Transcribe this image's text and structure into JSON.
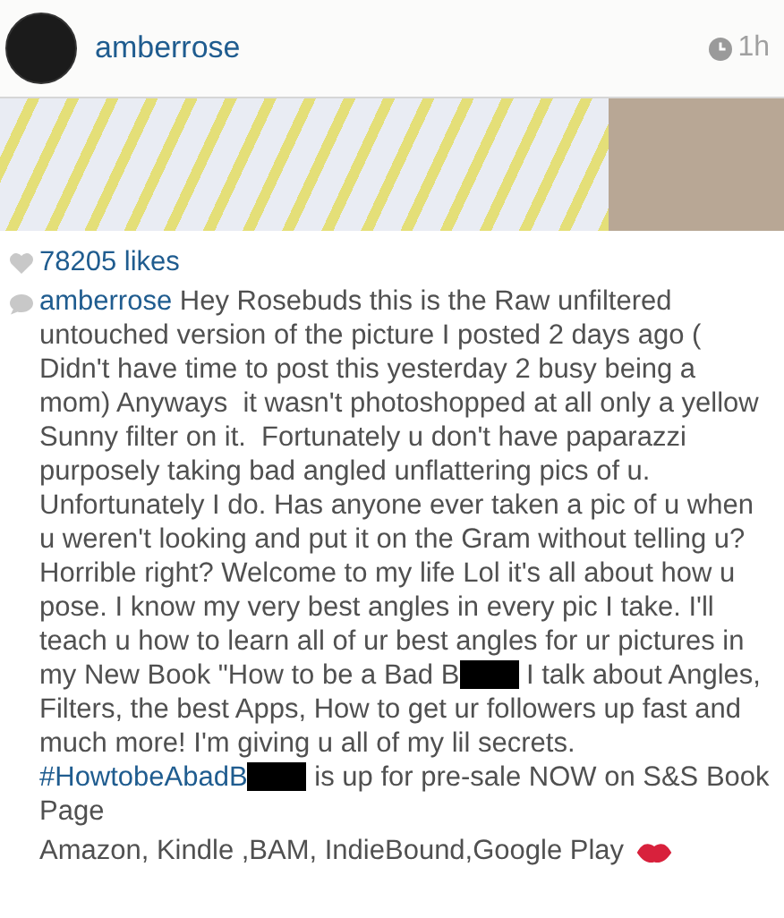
{
  "post": {
    "username": "amberrose",
    "time": "1h"
  },
  "likes": "78205 likes",
  "caption": {
    "username": "amberrose",
    "segments": [
      {
        "kind": "text",
        "text": "Hey Rosebuds this is the Raw unfiltered untouched version of the picture I posted 2 days ago ( Didn't have time to post this yesterday 2 busy being a mom) Anyways  it wasn't photoshopped at all only a yellow Sunny filter on it.  Fortunately u don't have paparazzi purposely taking bad angled unflattering pics of u. Unfortunately I do. Has anyone ever taken a pic of u when u weren't looking and put it on the Gram without telling u? Horrible right? Welcome to my life Lol it's all about how u pose. I know my very best angles in every pic I take. I'll teach u how to learn all of ur best angles for ur pictures in my New Book \"How to be a Bad B"
      },
      {
        "kind": "redaction"
      },
      {
        "kind": "text",
        "text": " I talk about Angles, Filters, the best Apps, How to get ur followers up fast and much more! I'm giving u all of my lil secrets. "
      },
      {
        "kind": "hashtag",
        "text": "#HowtobeAbadB"
      },
      {
        "kind": "redaction"
      },
      {
        "kind": "text",
        "text": " is up for pre-sale NOW on S&S Book Page"
      }
    ],
    "footer": "Amazon, Kindle ,BAM, IndieBound,Google Play"
  }
}
